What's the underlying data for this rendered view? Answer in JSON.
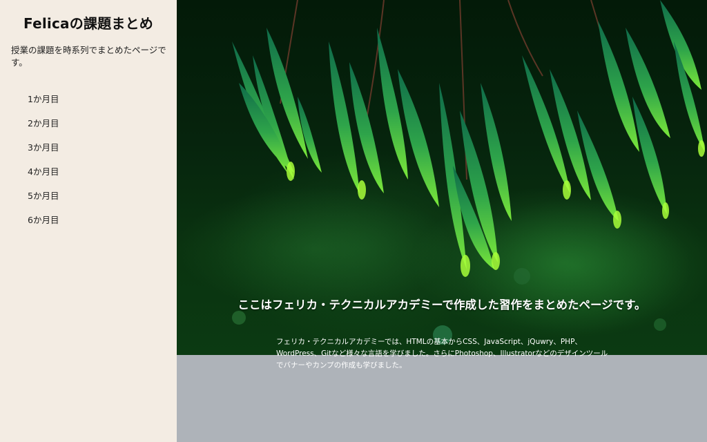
{
  "sidebar": {
    "title": "Felicaの課題まとめ",
    "description": "授業の課題を時系列でまとめたページです。",
    "items": [
      {
        "label": "1か月目"
      },
      {
        "label": "2か月目"
      },
      {
        "label": "3か月目"
      },
      {
        "label": "4か月目"
      },
      {
        "label": "5か月目"
      },
      {
        "label": "6か月目"
      }
    ],
    "background_color": "#f3ece3"
  },
  "hero": {
    "heading": "ここはフェリカ・テクニカルアカデミーで作成した習作をまとめたページです。",
    "text": "フェリカ・テクニカルアカデミーでは、HTMLの基本からCSS、JavaScript、jQuwry、PHP、WordPress、Gitなど様々な言語を学びました。さらにPhotoshop、Illustratorなどのデザインツールでバナーやカンプの作成も学びました。",
    "image_subject": "spruce-branches-photo",
    "band_color": "#aeb3b9"
  }
}
